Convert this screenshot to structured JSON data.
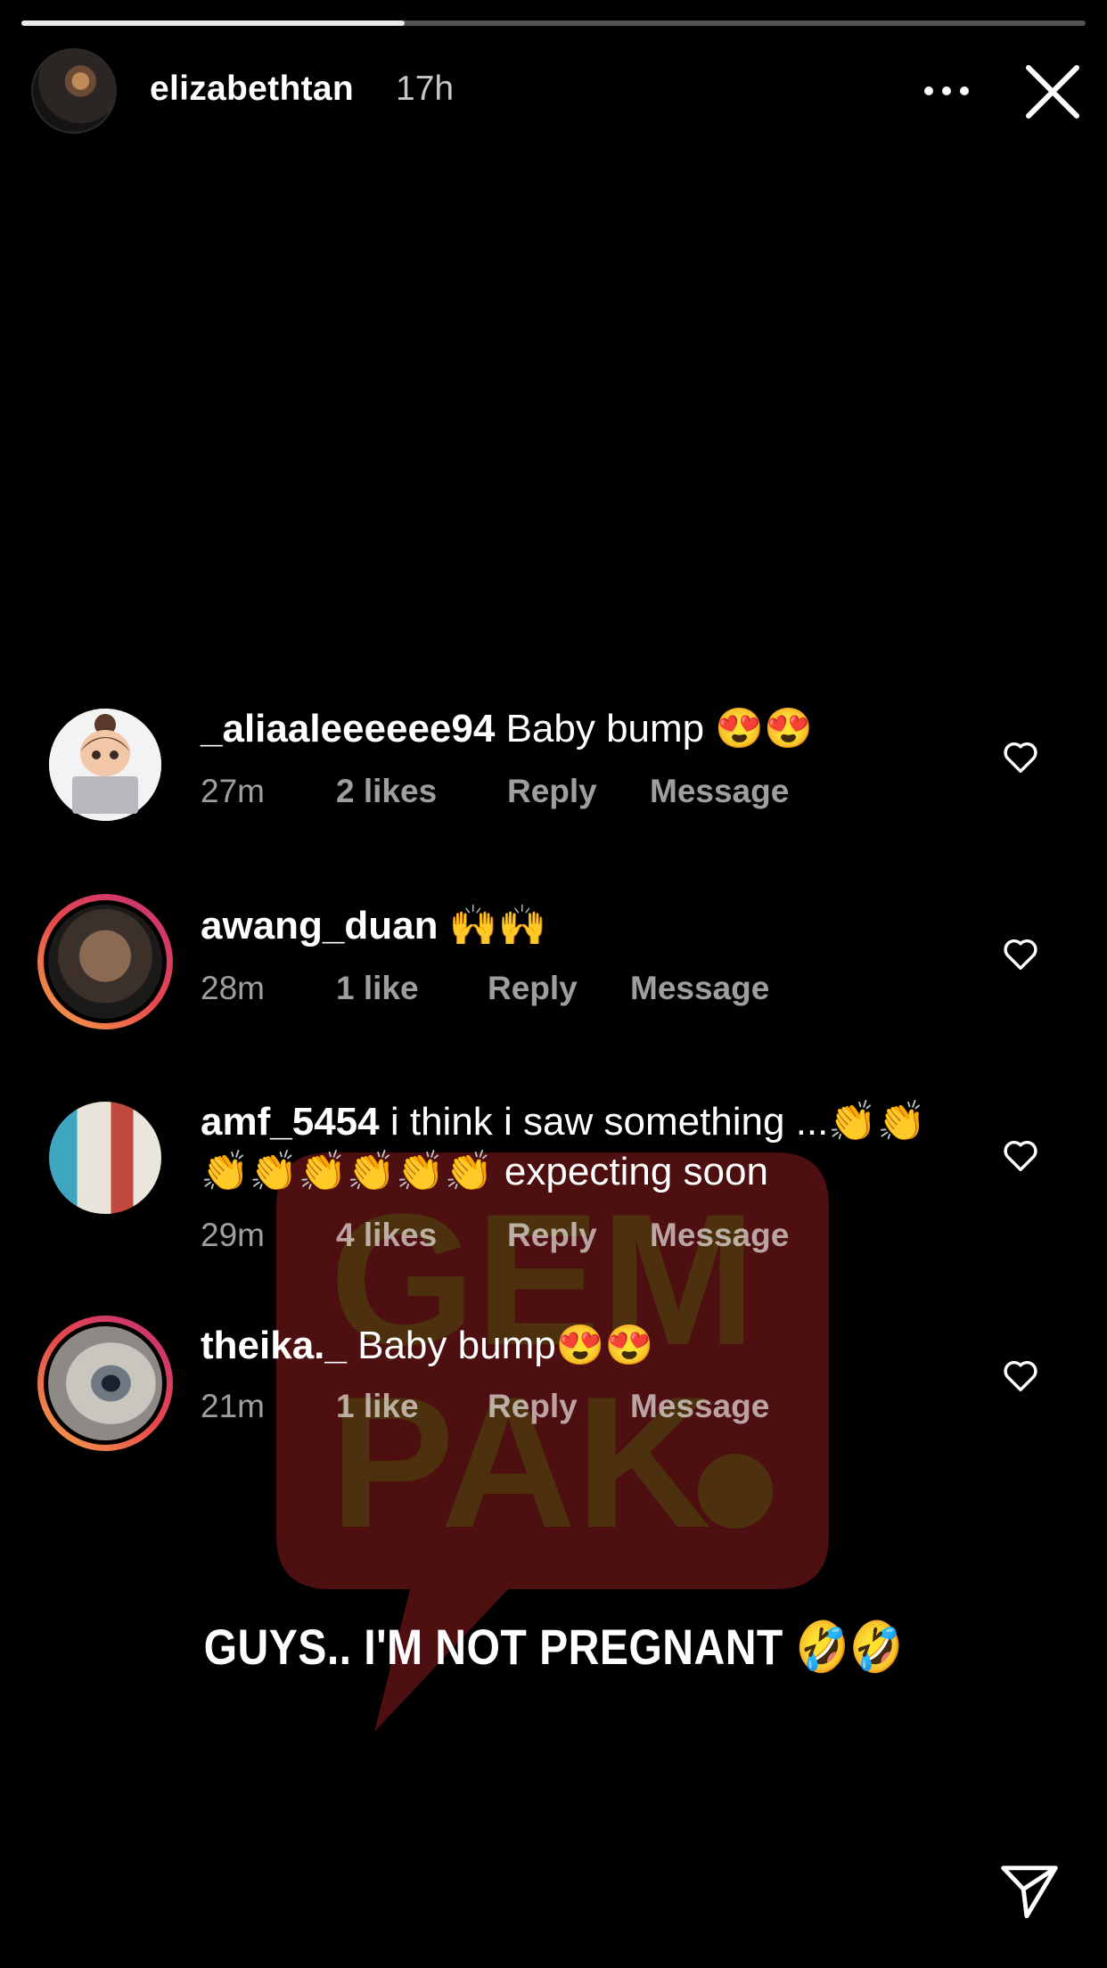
{
  "story": {
    "progress": 0.36,
    "username": "elizabethtan",
    "time": "17h"
  },
  "comments": [
    {
      "username": "_aliaaleeeeee94",
      "text": "Baby bump 😍😍",
      "time": "27m",
      "likes": "2 likes",
      "reply": "Reply",
      "message": "Message"
    },
    {
      "username": "awang_duan",
      "text": "🙌🙌",
      "time": "28m",
      "likes": "1 like",
      "reply": "Reply",
      "message": "Message"
    },
    {
      "username": "amf_5454",
      "text": "i think i saw something ...👏👏👏👏👏👏👏👏 expecting soon",
      "time": "29m",
      "likes": "4 likes",
      "reply": "Reply",
      "message": "Message"
    },
    {
      "username": "theika._",
      "text": "Baby bump😍😍",
      "time": "21m",
      "likes": "1 like",
      "reply": "Reply",
      "message": "Message"
    }
  ],
  "caption": "GUYS.. I'M NOT PREGNANT 🤣🤣",
  "watermark": {
    "line1": "GEM",
    "line2": "PAK",
    "color": "#6b1414"
  },
  "icons": {
    "more": "more-horizontal-icon",
    "close": "close-icon",
    "heart": "heart-outline-icon",
    "send": "send-icon"
  }
}
